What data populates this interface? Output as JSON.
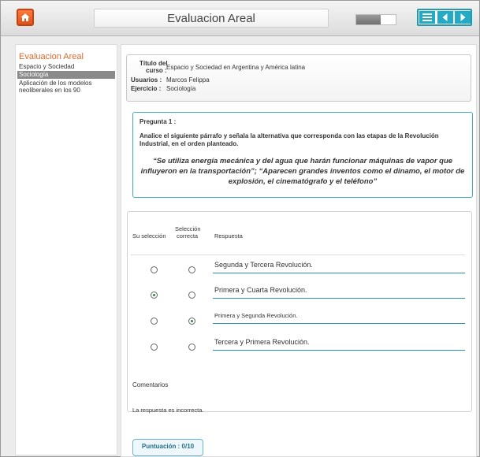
{
  "app": {
    "title": "Evaluacion Areal",
    "progress_fraction": 0.62
  },
  "colors": {
    "accent": "#26a9c2",
    "home": "#e0521a",
    "sidebar_title": "#e0682b",
    "selected_dot": "#2a8a3a"
  },
  "icons": {
    "home": "home-icon",
    "menu": "menu-icon",
    "prev": "arrow-left-icon",
    "next": "arrow-right-icon"
  },
  "sidebar": {
    "title": "Evaluacion Areal",
    "items": [
      {
        "label": "Espacio y Sociedad"
      },
      {
        "label": "Sociología"
      },
      {
        "label": "Aplicación de los modelos"
      },
      {
        "label": "neoliberales en los 90"
      }
    ]
  },
  "info": {
    "course_label_1": "Título del",
    "course_label_2": "curso :",
    "course_value": "Espacio y Sociedad en Argentina y América latina",
    "users_label": "Usuarios :",
    "users_value": "Marcos Felippa",
    "exercise_label": "Ejercicio :",
    "exercise_value": "Sociología"
  },
  "question": {
    "number": "Pregunta 1 :",
    "text": "Analice el siguiente párrafo y señala la alternativa que corresponda con las etapas de la Revolución Industrial, en el orden planteado.",
    "quote": "“Se utiliza energía mecánica y del agua que harán funcionar  máquinas de vapor que  influyeron en la transportación”; “Aparecen grandes inventos como el dinamo, el  motor de explosión, el cinematógrafo y el teléfono”"
  },
  "answers": {
    "headers": {
      "your_selection": "Su selección",
      "correct_1": "Selección",
      "correct_2": "correcta",
      "response": "Respuesta"
    },
    "rows": [
      {
        "text": "Segunda y Tercera Revolución.",
        "user_selected": false,
        "correct": false
      },
      {
        "text": "Primera y Cuarta Revolución.",
        "user_selected": true,
        "correct": false
      },
      {
        "text": "Primera y Segunda Revolución.",
        "user_selected": false,
        "correct": true
      },
      {
        "text": "Tercera y Primera Revolución.",
        "user_selected": false,
        "correct": false
      }
    ],
    "comments_label": "Comentarios",
    "comment": "La respuesta es incorrecta."
  },
  "score": {
    "label": "Puntuación : 0/10"
  }
}
